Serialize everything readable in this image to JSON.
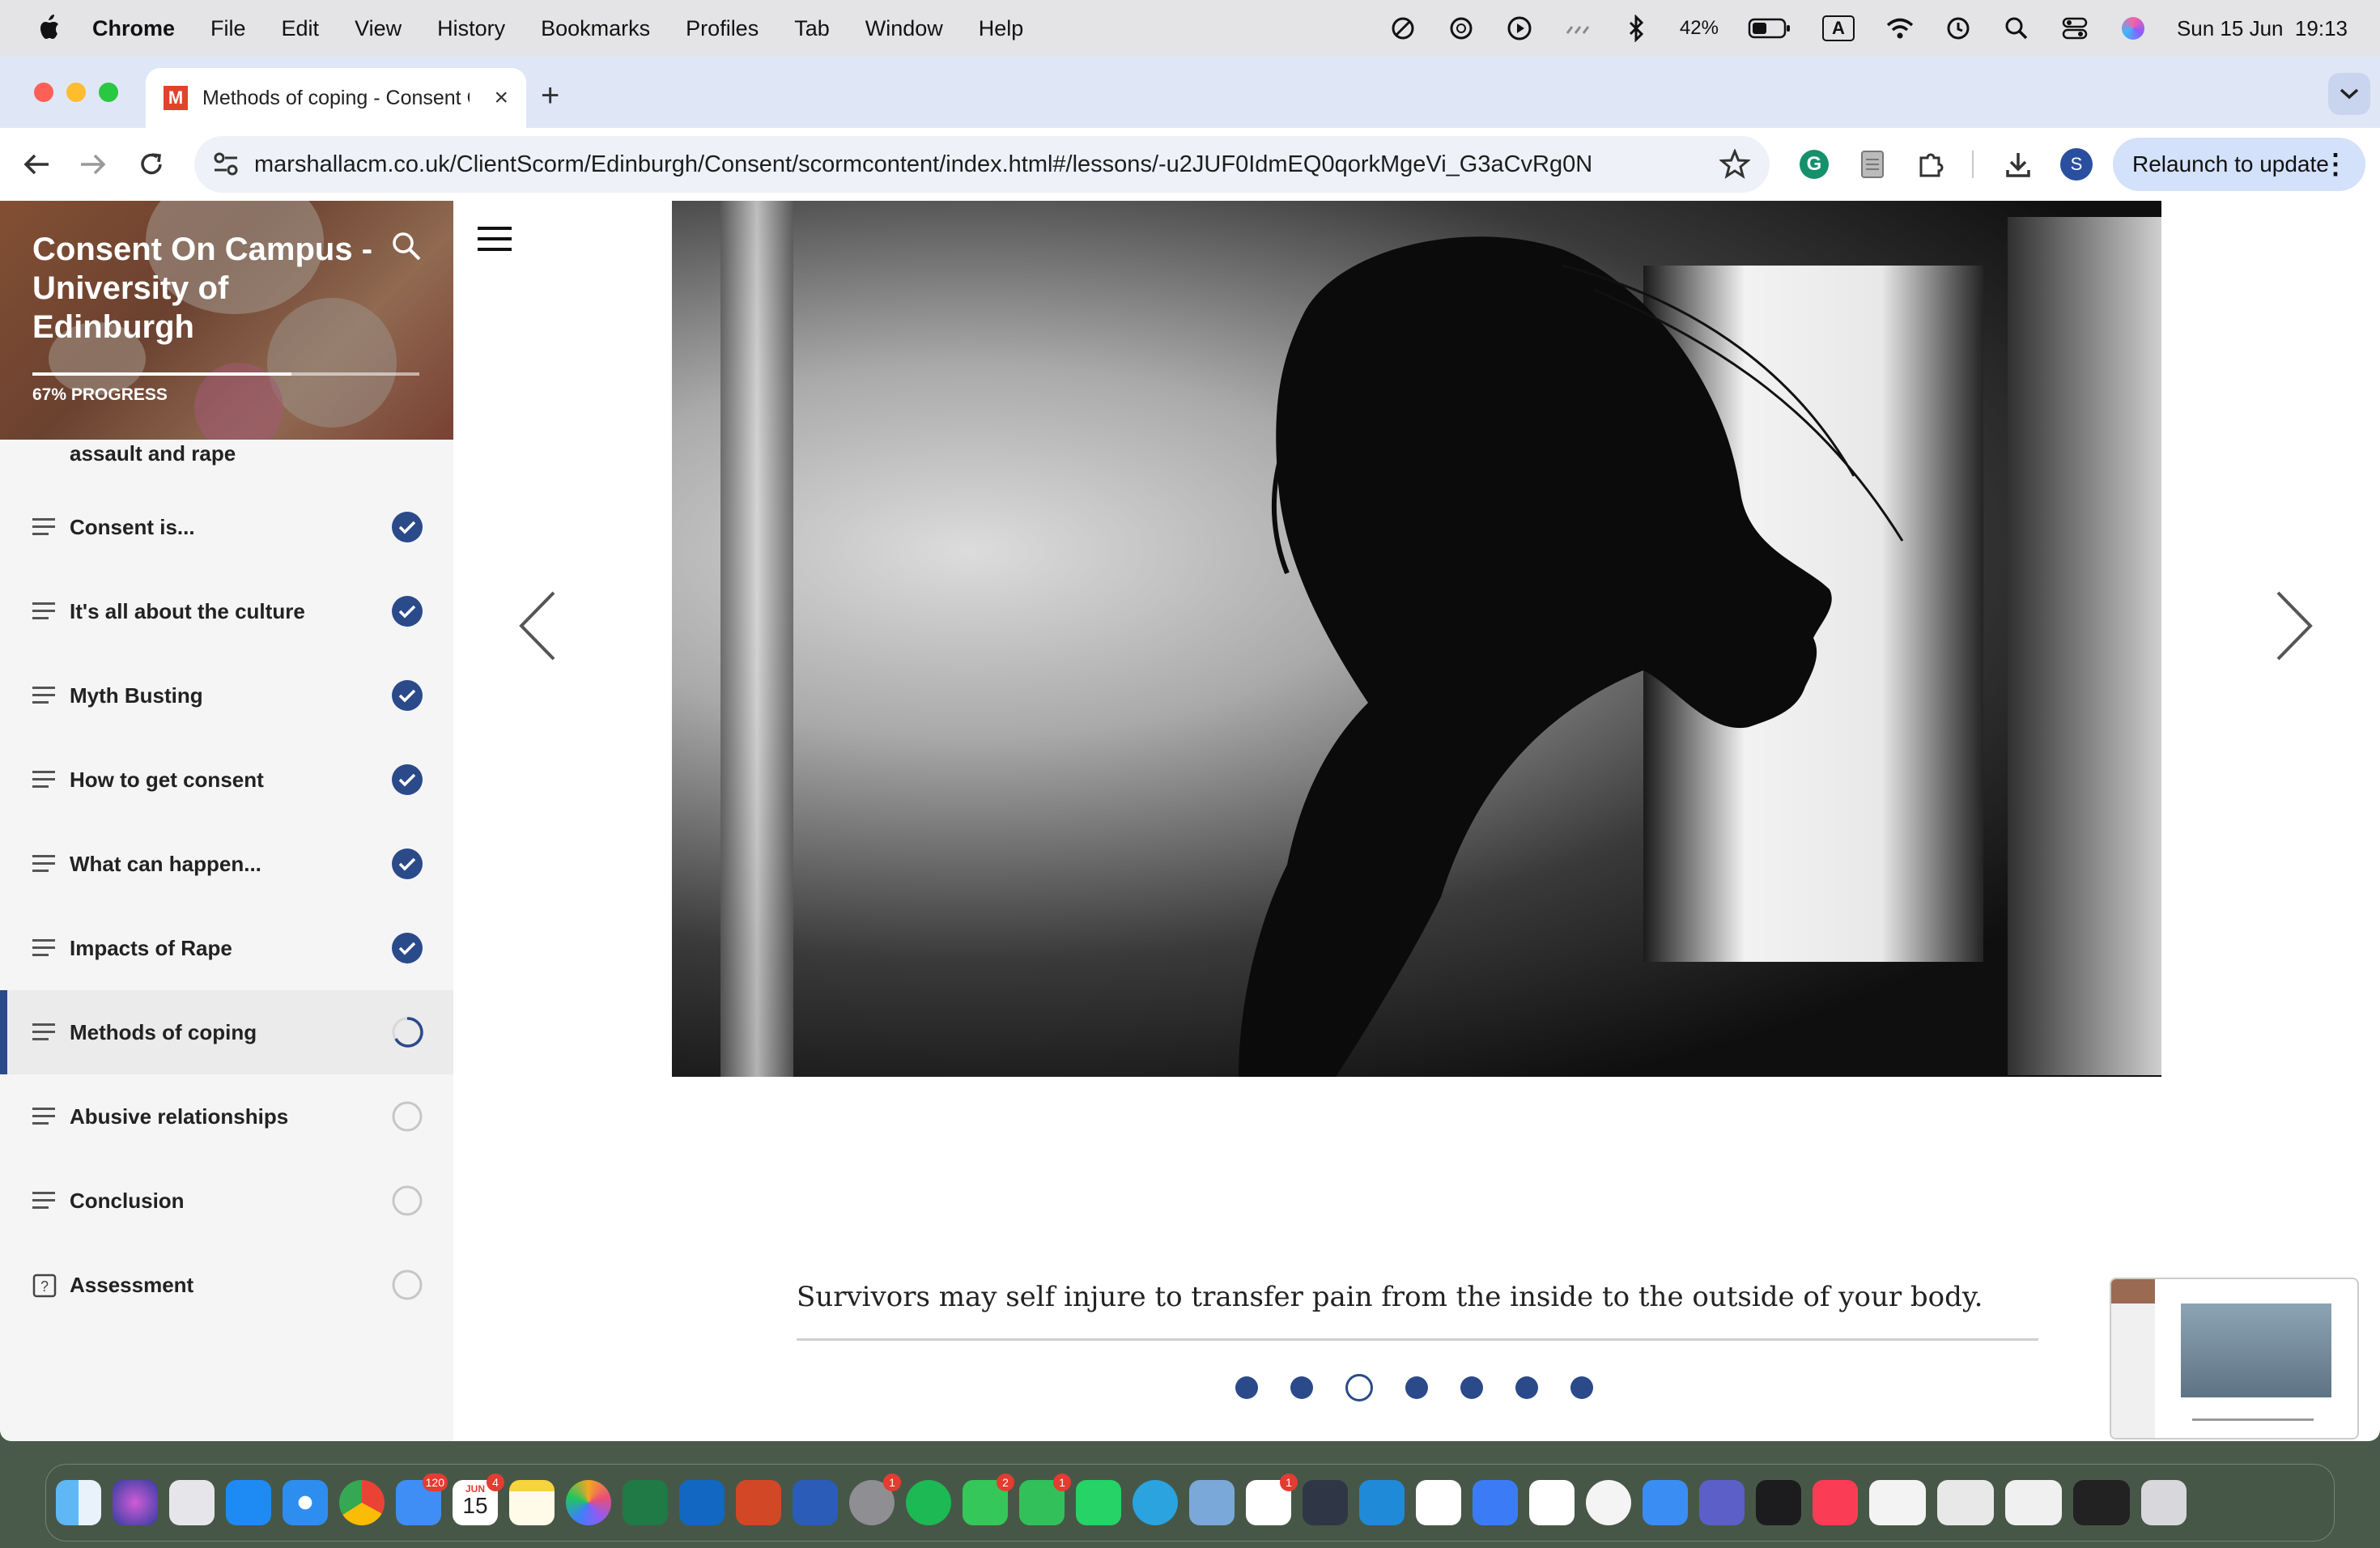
{
  "menubar": {
    "app": "Chrome",
    "items": [
      "File",
      "Edit",
      "View",
      "History",
      "Bookmarks",
      "Profiles",
      "Tab",
      "Window",
      "Help"
    ],
    "battery": "42%",
    "input_source": "A",
    "datetime": "Sun 15 Jun  19:13"
  },
  "tab": {
    "favicon_letter": "M",
    "title": "Methods of coping - Consent On Campus",
    "new_tab": "+",
    "close": "×"
  },
  "toolbar": {
    "url": "marshallacm.co.uk/ClientScorm/Edinburgh/Consent/scormcontent/index.html#/lessons/-u2JUF0IdmEQ0qorkMgeVi_G3aCvRg0N",
    "profile_initial": "S",
    "relaunch_label": "Relaunch to update",
    "relaunch_menu": "⋮"
  },
  "sidebar": {
    "course_title": "Consent On Campus - University of Edinburgh",
    "progress_label": "67% PROGRESS",
    "progress_value": 0.67,
    "clipped_item": "assault and rape",
    "lessons": [
      {
        "label": "Consent is...",
        "status": "complete"
      },
      {
        "label": "It's all about the culture",
        "status": "complete"
      },
      {
        "label": "Myth Busting",
        "status": "complete"
      },
      {
        "label": "How to get consent",
        "status": "complete"
      },
      {
        "label": "What can happen...",
        "status": "complete"
      },
      {
        "label": "Impacts of Rape",
        "status": "complete"
      },
      {
        "label": "Methods of coping",
        "status": "in-progress"
      },
      {
        "label": "Abusive relationships",
        "status": "not-started"
      },
      {
        "label": "Conclusion",
        "status": "not-started"
      },
      {
        "label": "Assessment",
        "status": "not-started"
      }
    ]
  },
  "main": {
    "caption": "Survivors may self injure to transfer pain from the inside to the outside of your body.",
    "slide_count": 7,
    "current_slide": 3
  },
  "dock": {
    "mail_badge": "120",
    "calendar_month": "JUN",
    "calendar_day": "15",
    "calendar_badge": "4",
    "settings_badge": "1",
    "messages_badge": "2",
    "facetime_badge": "1",
    "slack_badge": "1"
  },
  "colors": {
    "accent": "#2b4a8a",
    "tab_bar": "#dfe7f7",
    "relaunch": "#d3e1fb"
  }
}
